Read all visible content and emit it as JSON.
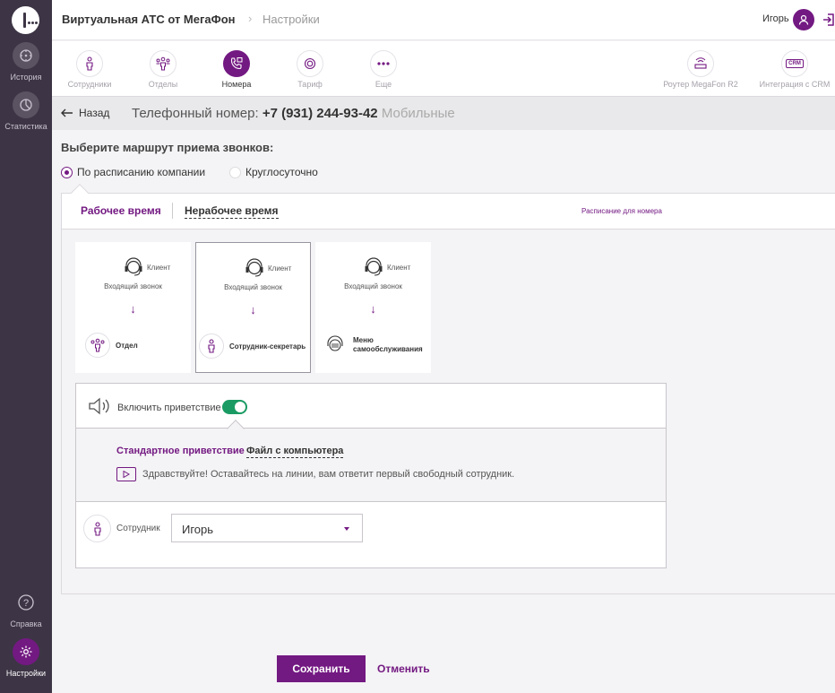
{
  "sidebar": {
    "items": [
      {
        "label": "История",
        "icon": "history-icon"
      },
      {
        "label": "Статистика",
        "icon": "statistics-icon"
      },
      {
        "label": "Справка",
        "icon": "help-icon"
      },
      {
        "label": "Настройки",
        "icon": "settings-icon",
        "active": true
      }
    ]
  },
  "header": {
    "title": "Виртуальная АТС от МегаФон",
    "separator": "›",
    "crumb": "Настройки",
    "user": "Игорь"
  },
  "tabs": [
    {
      "label": "Сотрудники",
      "icon": "employee-icon"
    },
    {
      "label": "Отделы",
      "icon": "department-icon"
    },
    {
      "label": "Номера",
      "icon": "phone-icon",
      "active": true
    },
    {
      "label": "Тариф",
      "icon": "tariff-icon"
    },
    {
      "label": "Еще",
      "icon": "more-icon"
    },
    {
      "label": "Роутер MegaFon R2",
      "icon": "router-icon"
    },
    {
      "label": "Интеграция с CRM",
      "icon": "crm-icon",
      "icon_text": "CRM"
    }
  ],
  "backrow": {
    "back_label": "Назад",
    "phone_prefix": "Телефонный номер:",
    "phone_number": "+7 (931) 244-93-42",
    "phone_type": "Мобильные"
  },
  "route": {
    "title": "Выберите маршрут приема звонков:",
    "options": [
      "По расписанию компании",
      "Круглосуточно"
    ],
    "selected": 0
  },
  "schedule_tabs": {
    "working": "Рабочее время",
    "nonworking": "Нерабочее время",
    "link": "Расписание для номера"
  },
  "cards": [
    {
      "client": "Клиент",
      "incoming": "Входящий звонок",
      "arrow": "↓",
      "target": "Отдел",
      "icon": "department-icon"
    },
    {
      "client": "Клиент",
      "incoming": "Входящий звонок",
      "arrow": "↓",
      "target": "Сотрудник-секретарь",
      "icon": "employee-icon",
      "selected": true
    },
    {
      "client": "Клиент",
      "incoming": "Входящий звонок",
      "arrow": "↓",
      "target": "Меню самообслуживания",
      "icon": "ivr-icon"
    }
  ],
  "greeting": {
    "toggle_label": "Включить приветствие",
    "enabled": true,
    "standard": "Стандартное приветствие",
    "file": "Файл с компьютера",
    "text": "Здравствуйте! Оставайтесь на линии, вам ответит первый свободный сотрудник.",
    "employee_label": "Сотрудник",
    "employee_value": "Игорь"
  },
  "actions": {
    "save": "Сохранить",
    "cancel": "Отменить"
  },
  "colors": {
    "brand": "#731982",
    "toggle_on": "#1a9b63",
    "sidebar": "#3d3545"
  }
}
